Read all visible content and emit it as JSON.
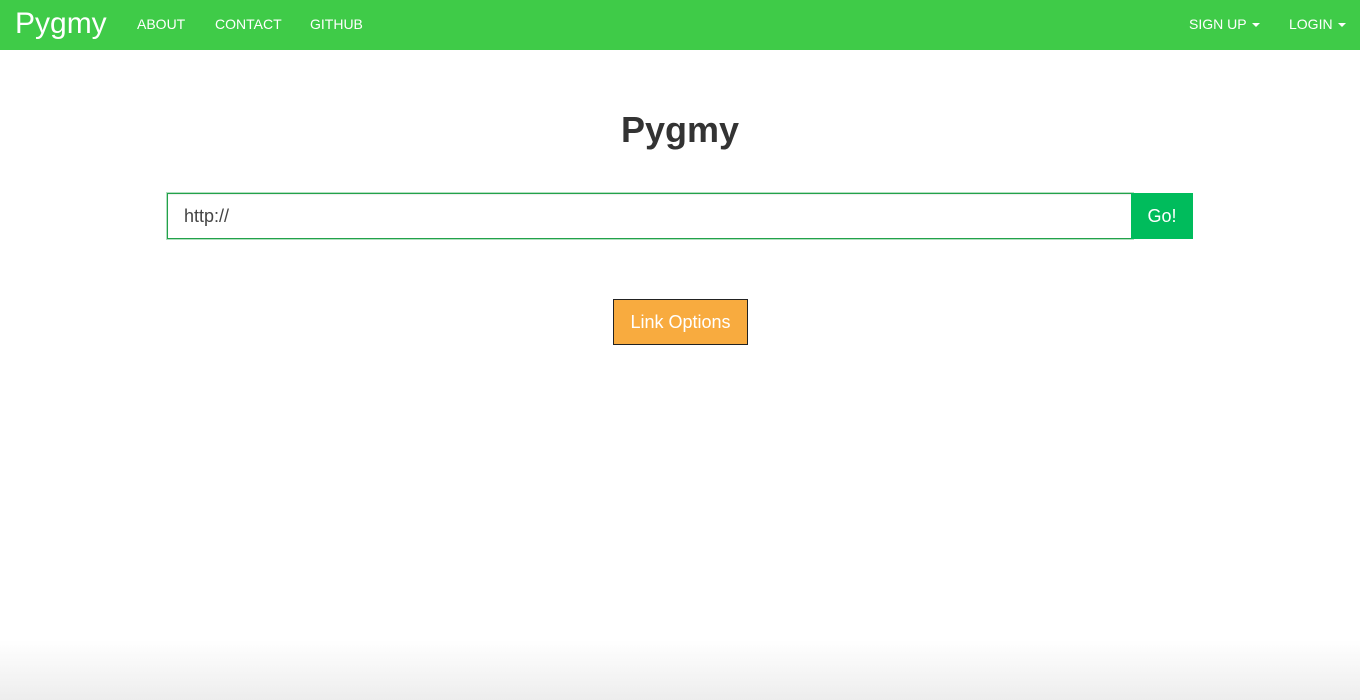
{
  "navbar": {
    "brand": "Pygmy",
    "links": {
      "about": "ABOUT",
      "contact": "CONTACT",
      "github": "GITHUB"
    },
    "right": {
      "signup": "SIGN UP",
      "login": "LOGIN"
    }
  },
  "main": {
    "title": "Pygmy",
    "url_input": {
      "value": "http://"
    },
    "go_label": "Go!",
    "link_options_label": "Link Options"
  },
  "colors": {
    "navbar": "#3fcb48",
    "go_button": "#00bc5c",
    "link_options_button": "#f8ab3f"
  }
}
